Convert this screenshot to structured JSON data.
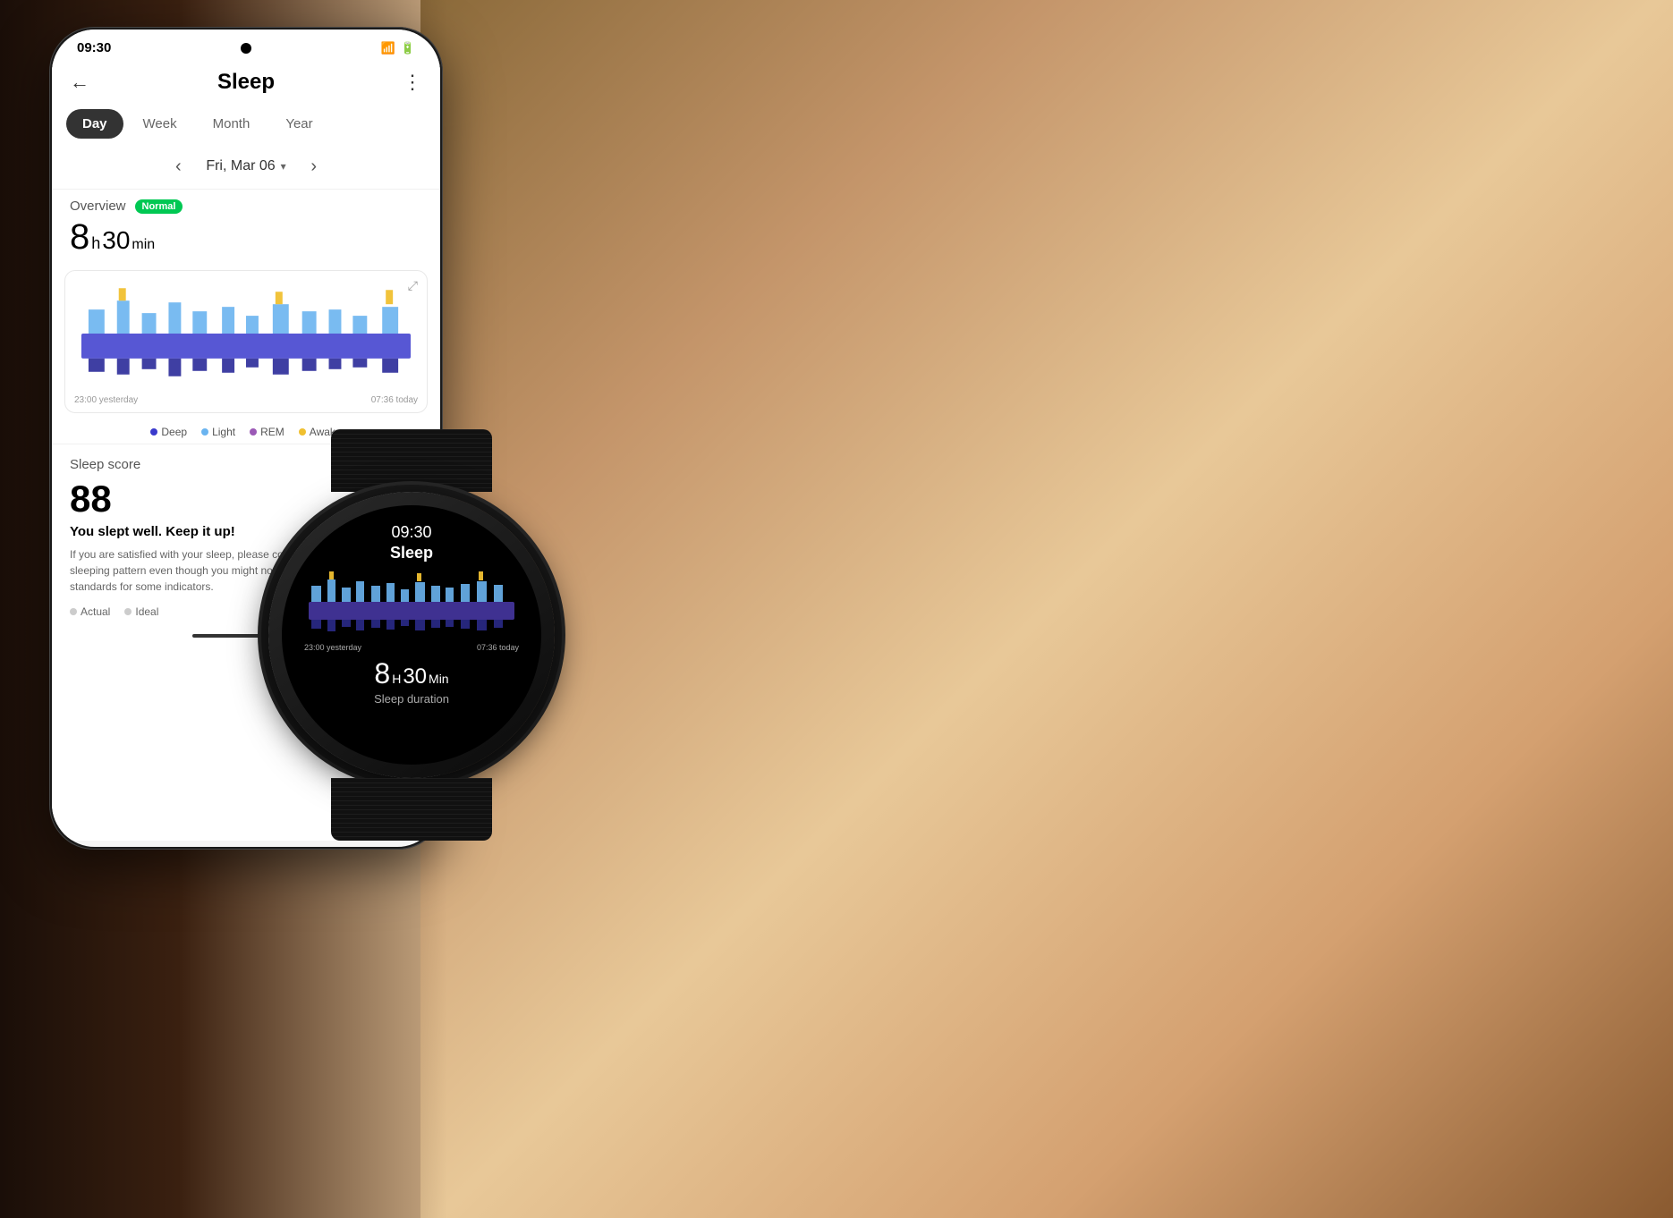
{
  "background": {
    "gradient_description": "Warm outdoor photo with person lying down"
  },
  "phone": {
    "status_bar": {
      "time": "09:30",
      "wifi_icon": "wifi",
      "signal_icon": "signal",
      "battery_icon": "battery"
    },
    "header": {
      "back_label": "←",
      "title": "Sleep",
      "menu_label": "⋮"
    },
    "tabs": [
      {
        "label": "Day",
        "active": true
      },
      {
        "label": "Week",
        "active": false
      },
      {
        "label": "Month",
        "active": false
      },
      {
        "label": "Year",
        "active": false
      }
    ],
    "date_nav": {
      "prev_arrow": "‹",
      "date": "Fri, Mar 06",
      "dropdown_arrow": "▾",
      "next_arrow": "›"
    },
    "overview": {
      "label": "Overview",
      "badge": "Normal",
      "hours": "8",
      "h_label": "h",
      "minutes": "30",
      "min_label": "min"
    },
    "chart": {
      "time_start": "23:00 yesterday",
      "time_end": "07:36 today",
      "expand_icon": "⤢"
    },
    "legend": [
      {
        "label": "Deep",
        "color": "#3a3acc"
      },
      {
        "label": "Light",
        "color": "#6ab4f0"
      },
      {
        "label": "REM",
        "color": "#9b59b6"
      },
      {
        "label": "Awake",
        "color": "#f0c030"
      }
    ],
    "sleep_score": {
      "title": "Sleep score",
      "score": "88",
      "message": "You slept well. Keep it up!",
      "description": "If you are satisfied with your sleep, please continue following your sleeping pattern even though you might not be meeting the recommended standards for some indicators.",
      "legend_actual": "Actual",
      "legend_ideal": "Ideal"
    }
  },
  "watch": {
    "time": "09:30",
    "title": "Sleep",
    "chart": {
      "time_start": "23:00 yesterday",
      "time_end": "07:36 today"
    },
    "duration": {
      "hours": "8",
      "h_label": "H",
      "minutes": "30",
      "min_label": "Min"
    },
    "sub_title": "Sleep duration"
  }
}
